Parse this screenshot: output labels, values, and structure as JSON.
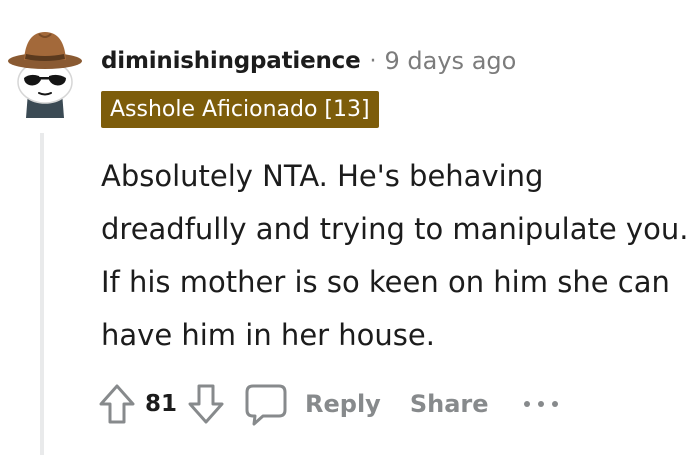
{
  "comment": {
    "author": {
      "username": "diminishingpatience",
      "avatar_icon": "snoo-cowboy-avatar-icon"
    },
    "separator": "·",
    "timestamp": "9 days ago",
    "flair": {
      "text": "Asshole Aficionado [13]",
      "background": "#7d5d0b",
      "color": "#ffffff"
    },
    "body": "Absolutely NTA. He's behaving dreadfully and trying to manipulate you. If his mother is so keen on him she can have him in her house.",
    "actions": {
      "upvote_icon": "arrow-up-icon",
      "vote_count": "81",
      "downvote_icon": "arrow-down-icon",
      "reply_icon": "speech-bubble-icon",
      "reply_label": "Reply",
      "share_label": "Share",
      "more_icon": "ellipsis-icon"
    }
  },
  "colors": {
    "text_primary": "#1c1c1c",
    "text_secondary": "#7c7c7c",
    "action_gray": "#878a8c",
    "thread_line": "#e9eaeb"
  }
}
